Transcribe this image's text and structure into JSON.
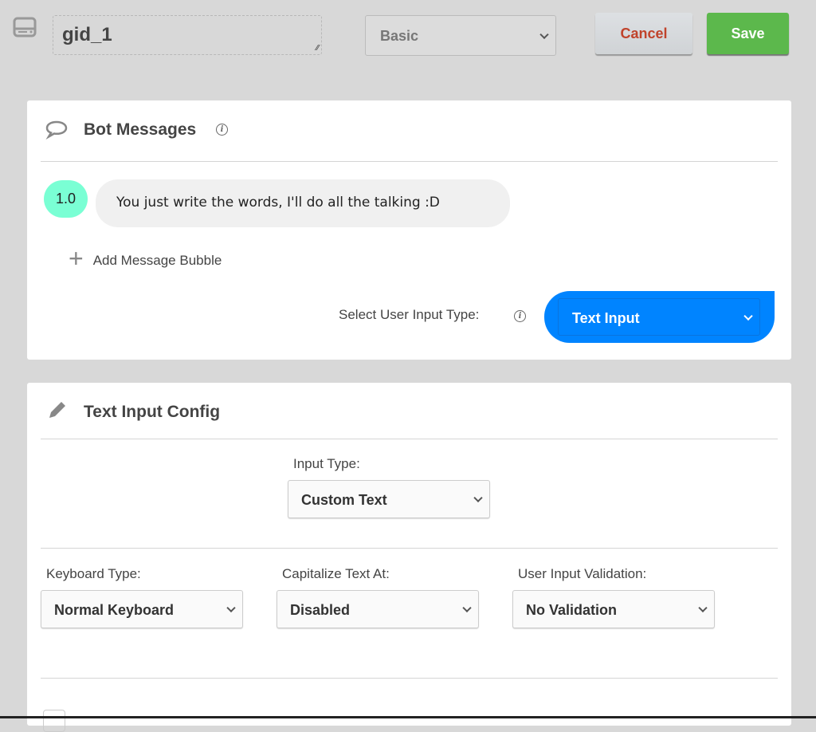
{
  "header": {
    "name_value": "gid_1",
    "mode_select": "Basic",
    "cancel_label": "Cancel",
    "save_label": "Save"
  },
  "bot_messages": {
    "title": "Bot Messages",
    "messages": [
      {
        "index": "1.0",
        "text": "You just write the words, I'll do all the talking :D"
      }
    ],
    "add_bubble_label": "Add Message Bubble",
    "input_type_label": "Select User Input Type:",
    "input_type_value": "Text Input"
  },
  "text_input_config": {
    "title": "Text Input Config",
    "input_type_label": "Input Type:",
    "input_type_value": "Custom Text",
    "keyboard_label": "Keyboard Type:",
    "keyboard_value": "Normal Keyboard",
    "capitalize_label": "Capitalize Text At:",
    "capitalize_value": "Disabled",
    "validation_label": "User Input Validation:",
    "validation_value": "No Validation"
  },
  "colors": {
    "accent": "#0084ff",
    "save": "#5cb84c",
    "cancel_text": "#c0432b",
    "index_badge": "#7affd4"
  }
}
